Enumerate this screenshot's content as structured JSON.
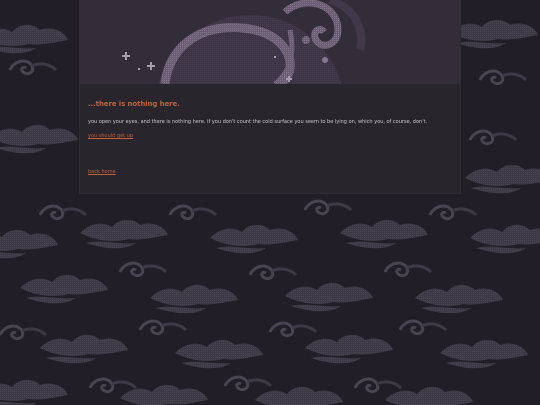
{
  "scene": {
    "heading": "...there is nothing here.",
    "description": "you open your eyes, and there is nothing here. if you don't count the cold surface you seem to be lying on, which you, of course, don't.",
    "action_link": "you should get up",
    "back_link": "back home"
  },
  "colors": {
    "background": "#211e27",
    "panel": "#28252d",
    "accent": "#c2603d",
    "text": "#cdc8d2",
    "cloud": "#4a4452"
  },
  "icons": [
    "swirl-icon",
    "sparkle-icon",
    "cloud-pattern"
  ]
}
